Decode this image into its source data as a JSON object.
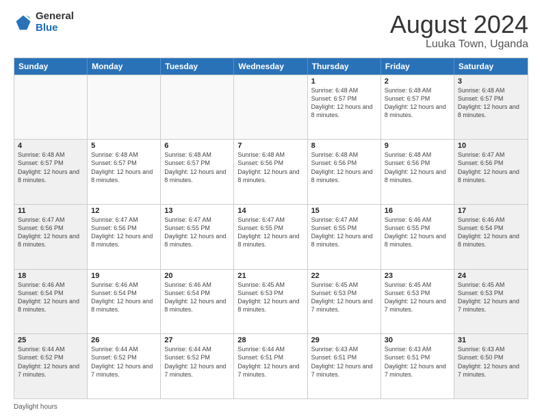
{
  "logo": {
    "general": "General",
    "blue": "Blue"
  },
  "header": {
    "title": "August 2024",
    "subtitle": "Luuka Town, Uganda"
  },
  "days_of_week": [
    "Sunday",
    "Monday",
    "Tuesday",
    "Wednesday",
    "Thursday",
    "Friday",
    "Saturday"
  ],
  "footer": {
    "label": "Daylight hours"
  },
  "weeks": [
    [
      {
        "day": "",
        "info": ""
      },
      {
        "day": "",
        "info": ""
      },
      {
        "day": "",
        "info": ""
      },
      {
        "day": "",
        "info": ""
      },
      {
        "day": "1",
        "info": "Sunrise: 6:48 AM\nSunset: 6:57 PM\nDaylight: 12 hours and 8 minutes."
      },
      {
        "day": "2",
        "info": "Sunrise: 6:48 AM\nSunset: 6:57 PM\nDaylight: 12 hours and 8 minutes."
      },
      {
        "day": "3",
        "info": "Sunrise: 6:48 AM\nSunset: 6:57 PM\nDaylight: 12 hours and 8 minutes."
      }
    ],
    [
      {
        "day": "4",
        "info": "Sunrise: 6:48 AM\nSunset: 6:57 PM\nDaylight: 12 hours and 8 minutes."
      },
      {
        "day": "5",
        "info": "Sunrise: 6:48 AM\nSunset: 6:57 PM\nDaylight: 12 hours and 8 minutes."
      },
      {
        "day": "6",
        "info": "Sunrise: 6:48 AM\nSunset: 6:57 PM\nDaylight: 12 hours and 8 minutes."
      },
      {
        "day": "7",
        "info": "Sunrise: 6:48 AM\nSunset: 6:56 PM\nDaylight: 12 hours and 8 minutes."
      },
      {
        "day": "8",
        "info": "Sunrise: 6:48 AM\nSunset: 6:56 PM\nDaylight: 12 hours and 8 minutes."
      },
      {
        "day": "9",
        "info": "Sunrise: 6:48 AM\nSunset: 6:56 PM\nDaylight: 12 hours and 8 minutes."
      },
      {
        "day": "10",
        "info": "Sunrise: 6:47 AM\nSunset: 6:56 PM\nDaylight: 12 hours and 8 minutes."
      }
    ],
    [
      {
        "day": "11",
        "info": "Sunrise: 6:47 AM\nSunset: 6:56 PM\nDaylight: 12 hours and 8 minutes."
      },
      {
        "day": "12",
        "info": "Sunrise: 6:47 AM\nSunset: 6:56 PM\nDaylight: 12 hours and 8 minutes."
      },
      {
        "day": "13",
        "info": "Sunrise: 6:47 AM\nSunset: 6:55 PM\nDaylight: 12 hours and 8 minutes."
      },
      {
        "day": "14",
        "info": "Sunrise: 6:47 AM\nSunset: 6:55 PM\nDaylight: 12 hours and 8 minutes."
      },
      {
        "day": "15",
        "info": "Sunrise: 6:47 AM\nSunset: 6:55 PM\nDaylight: 12 hours and 8 minutes."
      },
      {
        "day": "16",
        "info": "Sunrise: 6:46 AM\nSunset: 6:55 PM\nDaylight: 12 hours and 8 minutes."
      },
      {
        "day": "17",
        "info": "Sunrise: 6:46 AM\nSunset: 6:54 PM\nDaylight: 12 hours and 8 minutes."
      }
    ],
    [
      {
        "day": "18",
        "info": "Sunrise: 6:46 AM\nSunset: 6:54 PM\nDaylight: 12 hours and 8 minutes."
      },
      {
        "day": "19",
        "info": "Sunrise: 6:46 AM\nSunset: 6:54 PM\nDaylight: 12 hours and 8 minutes."
      },
      {
        "day": "20",
        "info": "Sunrise: 6:46 AM\nSunset: 6:54 PM\nDaylight: 12 hours and 8 minutes."
      },
      {
        "day": "21",
        "info": "Sunrise: 6:45 AM\nSunset: 6:53 PM\nDaylight: 12 hours and 8 minutes."
      },
      {
        "day": "22",
        "info": "Sunrise: 6:45 AM\nSunset: 6:53 PM\nDaylight: 12 hours and 7 minutes."
      },
      {
        "day": "23",
        "info": "Sunrise: 6:45 AM\nSunset: 6:53 PM\nDaylight: 12 hours and 7 minutes."
      },
      {
        "day": "24",
        "info": "Sunrise: 6:45 AM\nSunset: 6:53 PM\nDaylight: 12 hours and 7 minutes."
      }
    ],
    [
      {
        "day": "25",
        "info": "Sunrise: 6:44 AM\nSunset: 6:52 PM\nDaylight: 12 hours and 7 minutes."
      },
      {
        "day": "26",
        "info": "Sunrise: 6:44 AM\nSunset: 6:52 PM\nDaylight: 12 hours and 7 minutes."
      },
      {
        "day": "27",
        "info": "Sunrise: 6:44 AM\nSunset: 6:52 PM\nDaylight: 12 hours and 7 minutes."
      },
      {
        "day": "28",
        "info": "Sunrise: 6:44 AM\nSunset: 6:51 PM\nDaylight: 12 hours and 7 minutes."
      },
      {
        "day": "29",
        "info": "Sunrise: 6:43 AM\nSunset: 6:51 PM\nDaylight: 12 hours and 7 minutes."
      },
      {
        "day": "30",
        "info": "Sunrise: 6:43 AM\nSunset: 6:51 PM\nDaylight: 12 hours and 7 minutes."
      },
      {
        "day": "31",
        "info": "Sunrise: 6:43 AM\nSunset: 6:50 PM\nDaylight: 12 hours and 7 minutes."
      }
    ]
  ]
}
